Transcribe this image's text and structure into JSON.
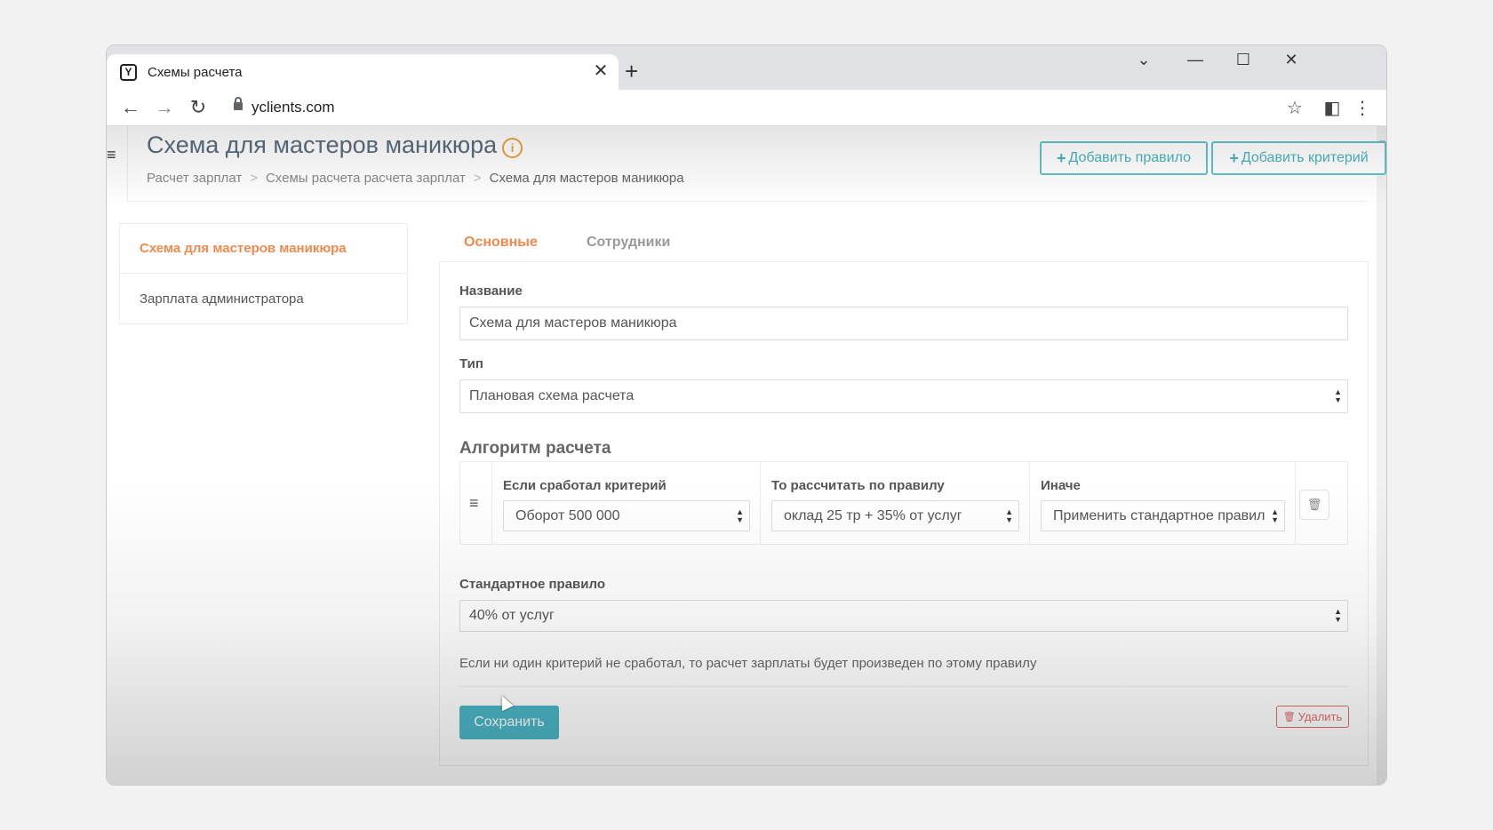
{
  "browser": {
    "tab_title": "Схемы расчета",
    "favicon_letter": "Y",
    "url": "yclients.com",
    "new_tab_symbol": "+",
    "close_tab_symbol": "✕"
  },
  "header": {
    "title": "Схема для мастеров маникюра",
    "breadcrumb": [
      "Расчет зарплат",
      "Схемы расчета расчета зарплат",
      "Схема для мастеров маникюра"
    ],
    "breadcrumb_separator": ">",
    "add_rule_label": "Добавить правило",
    "add_criterion_label": "Добавить критерий"
  },
  "sidebar": {
    "items": [
      {
        "label": "Схема для мастеров маникюра",
        "active": true
      },
      {
        "label": "Зарплата администратора",
        "active": false
      }
    ]
  },
  "tabs": {
    "main": "Основные",
    "staff": "Сотрудники"
  },
  "form": {
    "name_label": "Название",
    "name_value": "Схема для мастеров маникюра",
    "type_label": "Тип",
    "type_value": "Плановая схема расчета",
    "algorithm_title": "Алгоритм расчета",
    "rule": {
      "criterion_label": "Если сработал критерий",
      "criterion_value": "Оборот 500 000",
      "rule_label": "То рассчитать по правилу",
      "rule_value": "оклад 25 тр + 35% от услуг",
      "else_label": "Иначе",
      "else_value": "Применить стандартное правил"
    },
    "default_rule_label": "Стандартное правило",
    "default_rule_value": "40% от услуг",
    "hint": "Если ни один критерий не сработал, то расчет зарплаты будет произведен по этому правилу",
    "save_label": "Сохранить",
    "delete_label": "Удалить"
  },
  "colors": {
    "accent_orange": "#f2894c",
    "teal": "#4bb6c6",
    "danger": "#e06b6b"
  }
}
